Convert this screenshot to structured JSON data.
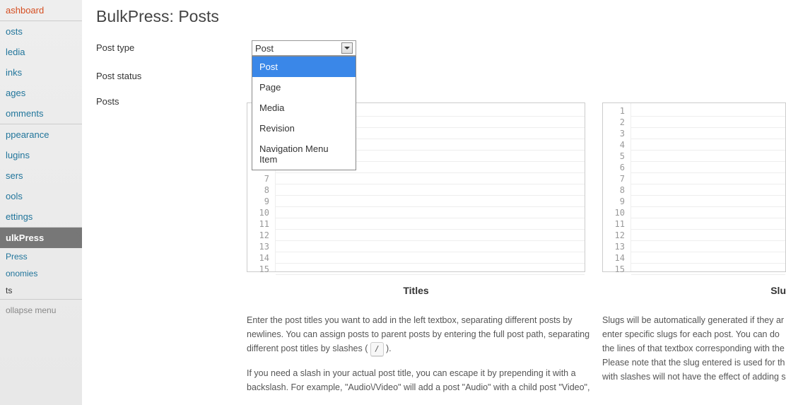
{
  "sidebar": {
    "top": [
      {
        "label": "ashboard"
      },
      {
        "label": "osts"
      },
      {
        "label": "ledia"
      },
      {
        "label": "inks"
      },
      {
        "label": "ages"
      },
      {
        "label": "omments"
      }
    ],
    "middle": [
      {
        "label": "ppearance"
      },
      {
        "label": "lugins"
      },
      {
        "label": "sers"
      },
      {
        "label": "ools"
      },
      {
        "label": "ettings"
      }
    ],
    "active": {
      "label": "ulkPress"
    },
    "subs": [
      {
        "label": "Press"
      },
      {
        "label": "onomies"
      },
      {
        "label": "ts",
        "current": true
      }
    ],
    "collapse": "ollapse menu"
  },
  "page": {
    "title": "BulkPress: Posts"
  },
  "form": {
    "post_type_label": "Post type",
    "post_status_label": "Post status",
    "posts_label": "Posts",
    "post_type_value": "Post",
    "post_type_options": [
      "Post",
      "Page",
      "Media",
      "Revision",
      "Navigation Menu Item"
    ]
  },
  "editors": {
    "lines": [
      "1",
      "2",
      "3",
      "4",
      "5",
      "6",
      "7",
      "8",
      "9",
      "10",
      "11",
      "12",
      "13",
      "14",
      "15"
    ],
    "titles_heading": "Titles",
    "slugs_heading": "Slu"
  },
  "help": {
    "titles_p1": "Enter the post titles you want to add in the left textbox, separating different posts by newlines. You can assign posts to parent posts by entering the full post path, separating different post titles by slashes (",
    "titles_p1_key": "/",
    "titles_p1_end": ").",
    "titles_p2": "If you need a slash in your actual post title, you can escape it by prepending it with a backslash. For example, \"Audio\\/Video\" will add a post \"Audio\" with a child post \"Video\",",
    "slugs_p1": "Slugs will be automatically generated if they ar enter specific slugs for each post. You can do the lines of that textbox corresponding with the Please note that the slug entered is used for th with slashes will not have the effect of adding s"
  }
}
